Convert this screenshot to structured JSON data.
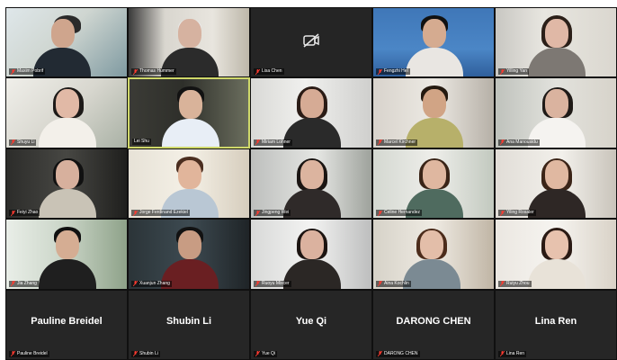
{
  "meeting": {
    "tiles": [
      {
        "name": "Maxim Pobrif",
        "mic_muted": true
      },
      {
        "name": "Thomas Hummer",
        "mic_muted": true
      },
      {
        "name": "Lisa Chen",
        "mic_muted": true
      },
      {
        "name": "Fengzhi Hel",
        "mic_muted": true
      },
      {
        "name": "Yilling Yan",
        "mic_muted": true
      },
      {
        "name": "Shuyu Li",
        "mic_muted": true
      },
      {
        "name": "Lei Shu",
        "mic_muted": false
      },
      {
        "name": "Miriam Lohner",
        "mic_muted": true
      },
      {
        "name": "Marcel Kirchner",
        "mic_muted": true
      },
      {
        "name": "Ana Manousidu",
        "mic_muted": true
      },
      {
        "name": "Feiyi Zhao",
        "mic_muted": true
      },
      {
        "name": "Jorge Ferdinand Ezekiel",
        "mic_muted": true
      },
      {
        "name": "Jingpeng Wei",
        "mic_muted": true
      },
      {
        "name": "Celine Hernandez",
        "mic_muted": true
      },
      {
        "name": "Yiling Rosaler",
        "mic_muted": true
      },
      {
        "name": "Jia Zhang",
        "mic_muted": true
      },
      {
        "name": "Xuanjun Zhang",
        "mic_muted": true
      },
      {
        "name": "Ruoyu Mixcer",
        "mic_muted": true
      },
      {
        "name": "Aina Kochlin",
        "mic_muted": true
      },
      {
        "name": "Ruiyu Zhou",
        "mic_muted": true
      },
      {
        "name": "Pauline Breidel",
        "mic_muted": true
      },
      {
        "name": "Shubin Li",
        "mic_muted": true
      },
      {
        "name": "Yue Qi",
        "mic_muted": true
      },
      {
        "name": "DARONG CHEN",
        "mic_muted": true
      },
      {
        "name": "Lina Ren",
        "mic_muted": true
      }
    ]
  },
  "colors": {
    "active_speaker_border": "#cfd86a",
    "muted_mic": "#ff3b30"
  }
}
